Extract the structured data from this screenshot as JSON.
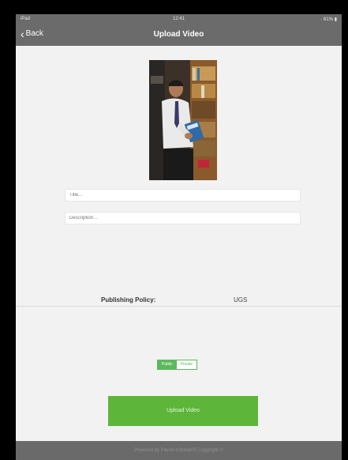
{
  "status_bar": {
    "left": "iPad",
    "time": "12:41",
    "right": " · 61% ▮"
  },
  "nav": {
    "back_label": "Back",
    "title": "Upload Video"
  },
  "form": {
    "title_placeholder": "Title...",
    "description_placeholder": "Description..."
  },
  "policy": {
    "label": "Publishing Policy:",
    "value": "UGS"
  },
  "visibility": {
    "options": [
      "Public",
      "Private"
    ],
    "selected": "Public"
  },
  "upload_button": "Upload Video",
  "footer": "Powered by Planet eStream® Copyright ©",
  "colors": {
    "accent": "#5db53a",
    "nav_bg": "#6b6b6b",
    "page_bg": "#f2f2f2"
  }
}
